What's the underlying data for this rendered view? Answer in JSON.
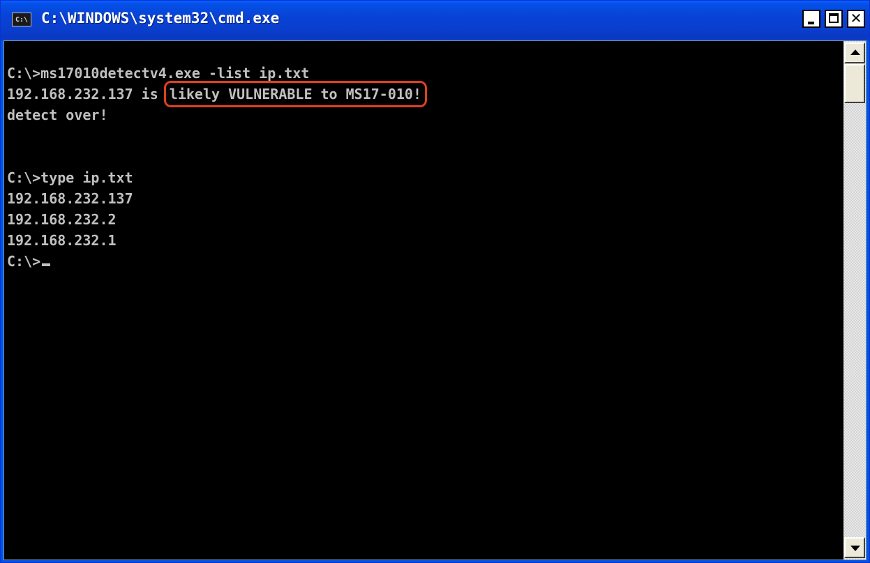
{
  "window": {
    "title": "C:\\WINDOWS\\system32\\cmd.exe",
    "icon_label": "C:\\",
    "icon": "cmd-icon",
    "controls": {
      "minimize": "minimize-icon",
      "maximize": "maximize-icon",
      "close": "close-icon",
      "close_glyph": "✕"
    }
  },
  "console": {
    "lines": [
      {
        "text": "C:\\>ms17010detectv4.exe -list ip.txt"
      },
      {
        "prefix": "192.168.232.137 is ",
        "highlighted": "likely VULNERABLE to MS17-010!"
      },
      {
        "text": "detect over!"
      },
      {
        "text": ""
      },
      {
        "text": ""
      },
      {
        "text": "C:\\>type ip.txt"
      },
      {
        "text": "192.168.232.137"
      },
      {
        "text": "192.168.232.2"
      },
      {
        "text": "192.168.232.1"
      },
      {
        "text": "C:\\>"
      }
    ]
  },
  "colors": {
    "titlebar": "#0843d6",
    "console_bg": "#000000",
    "console_fg": "#c0c0c0",
    "highlight_outline": "#e0411c"
  }
}
